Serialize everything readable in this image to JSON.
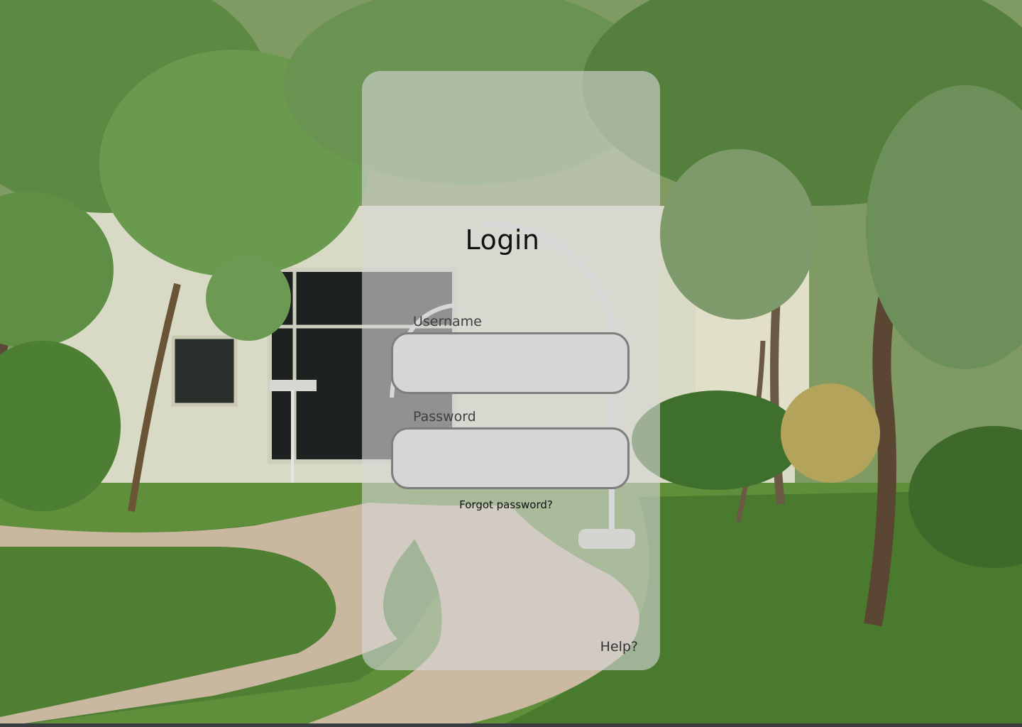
{
  "login": {
    "title": "Login",
    "username_label": "Username",
    "username_value": "",
    "password_label": "Password",
    "password_value": "",
    "forgot_password": "Forgot password?",
    "help": "Help?"
  },
  "colors": {
    "card_background": "#d7d7d7",
    "input_background": "#d6d6d6",
    "input_border": "#7e7e7e",
    "title_text": "#111111"
  },
  "background": {
    "description_icon": "campus-garden-photo"
  }
}
